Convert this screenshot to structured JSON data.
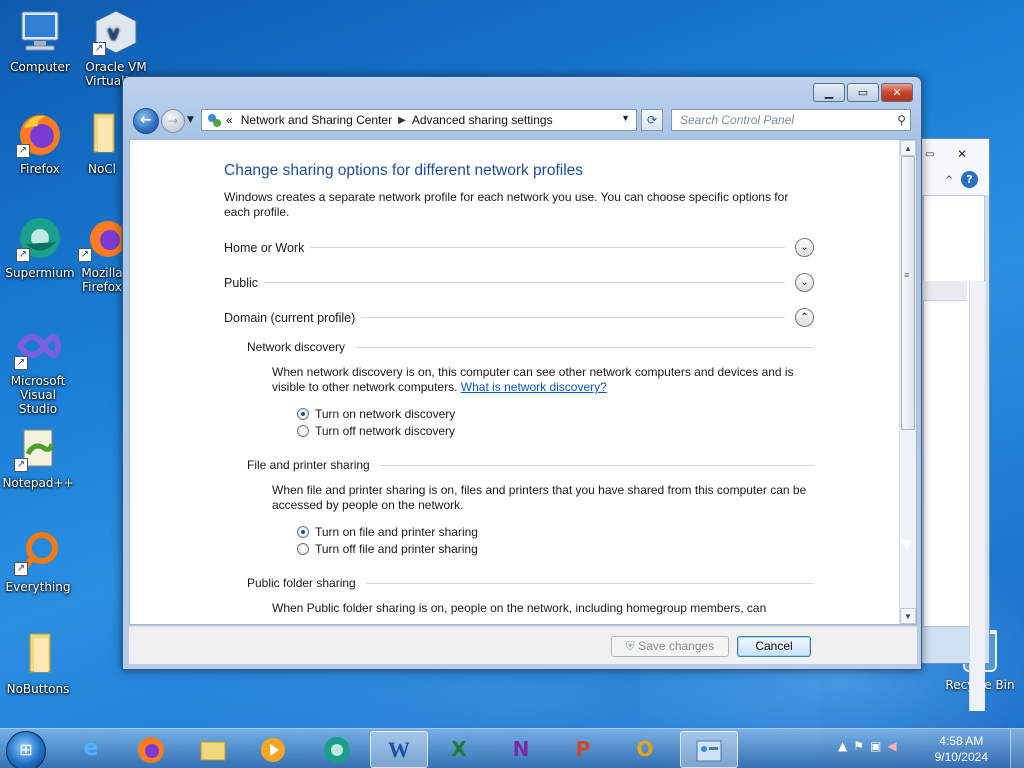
{
  "desktop": {
    "icons": [
      {
        "label": "Computer"
      },
      {
        "label": "Oracle VM VirtualBox"
      },
      {
        "label": "Firefox"
      },
      {
        "label": "NoCl"
      },
      {
        "label": "Supermium"
      },
      {
        "label": "Mozilla Firefox"
      },
      {
        "label": "Microsoft Visual Studio"
      },
      {
        "label": "Notepad++"
      },
      {
        "label": "Everything"
      },
      {
        "label": "NoButtons"
      }
    ],
    "recycle_bin": "Recycle Bin"
  },
  "window": {
    "breadcrumb": {
      "overflow": "«",
      "items": [
        "Network and Sharing Center",
        "Advanced sharing settings"
      ]
    },
    "search": {
      "placeholder": "Search Control Panel"
    },
    "heading": "Change sharing options for different network profiles",
    "intro": "Windows creates a separate network profile for each network you use. You can choose specific options for each profile.",
    "profiles": [
      {
        "label": "Home or Work",
        "expanded": false
      },
      {
        "label": "Public",
        "expanded": false
      },
      {
        "label": "Domain (current profile)",
        "expanded": true
      }
    ],
    "network_discovery": {
      "title": "Network discovery",
      "desc": "When network discovery is on, this computer can see other network computers and devices and is visible to other network computers.",
      "link": "What is network discovery?",
      "options": [
        "Turn on network discovery",
        "Turn off network discovery"
      ],
      "selected": 0
    },
    "file_printer": {
      "title": "File and printer sharing",
      "desc": "When file and printer sharing is on, files and printers that you have shared from this computer can be accessed by people on the network.",
      "options": [
        "Turn on file and printer sharing",
        "Turn off file and printer sharing"
      ],
      "selected": 0
    },
    "public_folder": {
      "title": "Public folder sharing",
      "desc": "When Public folder sharing is on, people on the network, including homegroup members, can"
    },
    "buttons": {
      "save": "Save changes",
      "cancel": "Cancel"
    }
  },
  "taskbar": {
    "time": "4:58 AM",
    "date": "9/10/2024"
  },
  "colors": {
    "heading": "#1f4e96",
    "link": "#0b55c4",
    "desktop": "#1a7fd6"
  }
}
